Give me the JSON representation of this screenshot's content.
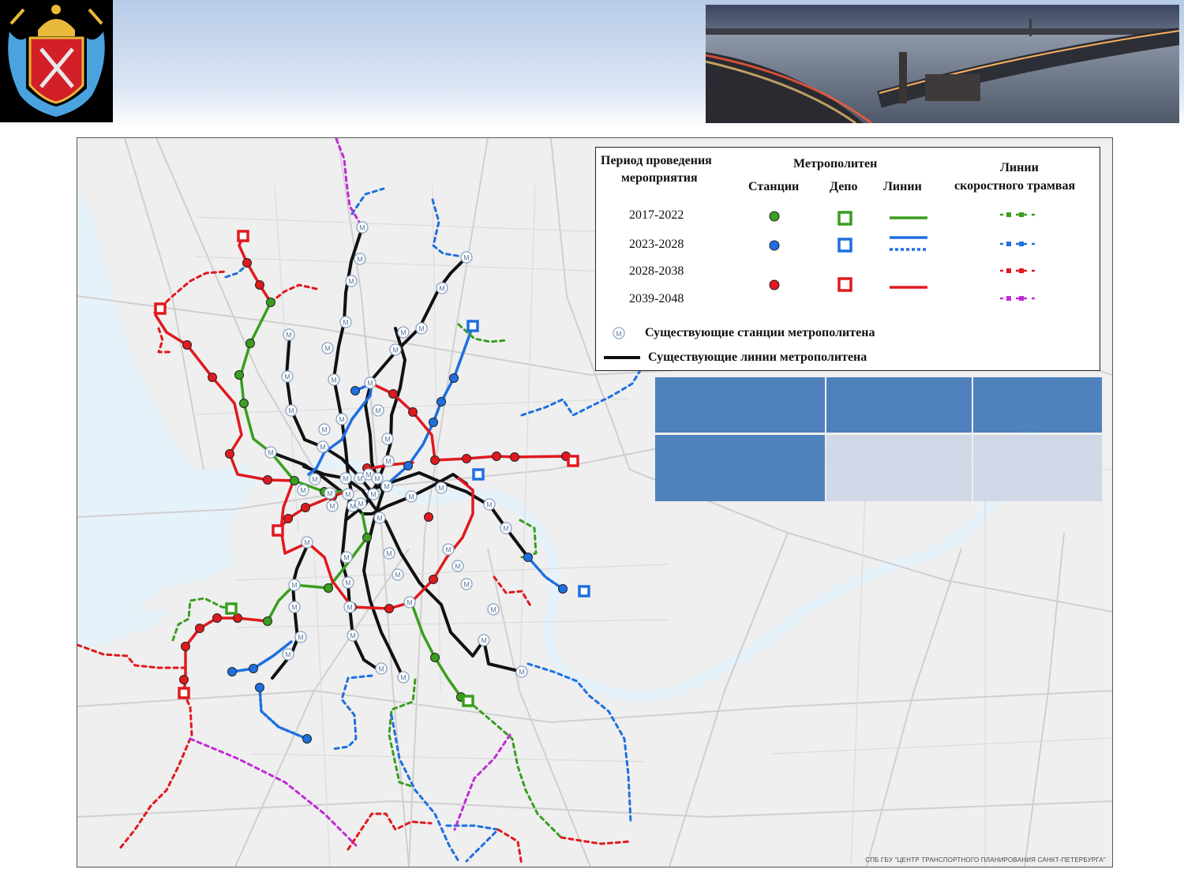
{
  "legend": {
    "period_header": [
      "Период проведения",
      "мероприятия"
    ],
    "metro_header": "Метрополитен",
    "col_stations": "Станции",
    "col_depot": "Депо",
    "col_lines": "Линии",
    "tram_header": [
      "Линии",
      "скоростного трамвая"
    ],
    "periods": [
      "2017-2022",
      "2023-2028",
      "2028-2038",
      "2039-2048"
    ],
    "existing_stations": "Существующие станции метрополитена",
    "existing_lines": "Существующие линии метрополитена"
  },
  "colors": {
    "p2017": "#3a9e1f",
    "p2023": "#1e6fe0",
    "p2028": "#e0191e",
    "p2039": "#c22ad6",
    "existing": "#111111",
    "table_dark": "#4f81bd",
    "table_light": "#d0d8e8"
  },
  "icons": {
    "existing_station": "metro-station-icon",
    "coat_of_arms": "coat-of-arms-icon"
  },
  "credit": "СПБ ГБУ \"ЦЕНТР ТРАНСПОРТНОГО ПЛАНИРОВАНИЯ САНКТ-ПЕТЕРБУРГА\""
}
